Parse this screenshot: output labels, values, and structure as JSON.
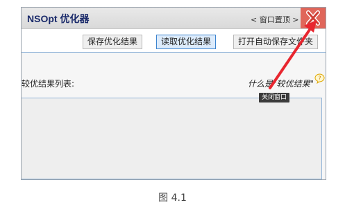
{
  "window": {
    "title": "NSOpt 优化器",
    "pin_label": "< 窗口置顶 >"
  },
  "toolbar": {
    "save_label": "保存优化结果",
    "read_label": "读取优化结果",
    "open_folder_label": "打开自动保存文件夹"
  },
  "main": {
    "list_label": "较优结果列表:",
    "help_link": "什么是\"较优结果\"",
    "tooltip": "关闭窗口"
  },
  "caption": "图 4.1",
  "colors": {
    "title_text": "#1a2a6a",
    "close_bg": "#e0665a",
    "arrow": "#e8262f",
    "active_border": "#3c84cf"
  },
  "icons": {
    "close": "close-x-icon",
    "help": "question-bubble-icon",
    "marker": "red-dot-marker-icon"
  }
}
